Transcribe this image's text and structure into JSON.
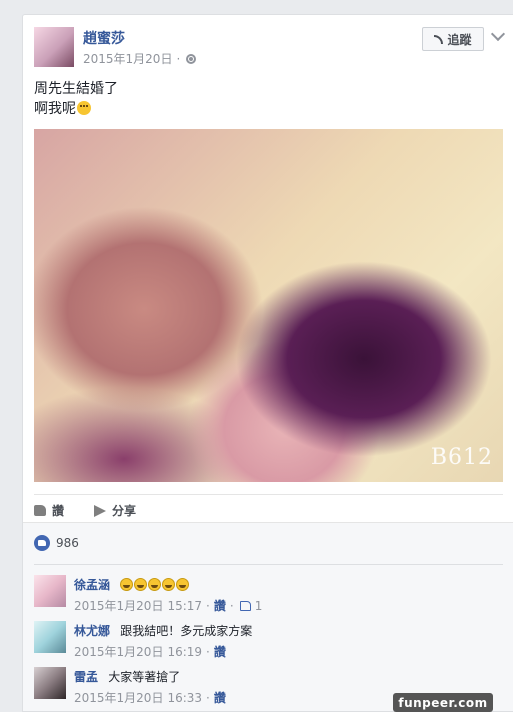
{
  "post": {
    "author": "趙蜜莎",
    "date": "2015年1月20日",
    "separator": "·",
    "follow_label": "追蹤",
    "text_line1": "周先生結婚了",
    "text_line2": "啊我呢",
    "photo_watermark": "B612"
  },
  "actions": {
    "like_label": "讚",
    "share_label": "分享"
  },
  "likes": {
    "count": "986"
  },
  "comments": [
    {
      "name": "徐孟涵",
      "text": "",
      "emoji_count": 5,
      "date": "2015年1月20日",
      "time": "15:17",
      "like_link": "讚",
      "likes": "1"
    },
    {
      "name": "林尤娜",
      "text": "跟我結吧！多元成家方案",
      "date": "2015年1月20日",
      "time": "16:19",
      "like_link": "讚"
    },
    {
      "name": "雷孟",
      "text": "大家等著搶了",
      "date": "2015年1月20日",
      "time": "16:33",
      "like_link": "讚"
    }
  ],
  "site_badge": "funpeer.com",
  "colors": {
    "link_blue": "#365899",
    "like_blue": "#4267b2",
    "meta_gray": "#90949c"
  }
}
